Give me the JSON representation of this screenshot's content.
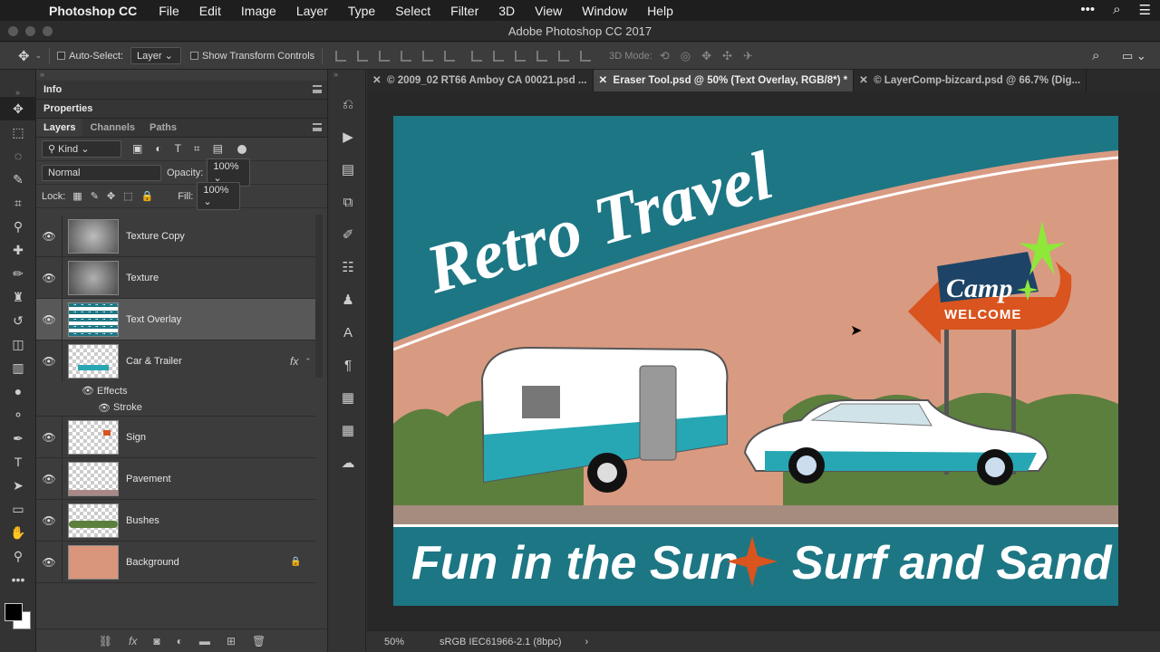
{
  "menubar": {
    "app": "Photoshop CC",
    "items": [
      "File",
      "Edit",
      "Image",
      "Layer",
      "Type",
      "Select",
      "Filter",
      "3D",
      "View",
      "Window",
      "Help"
    ]
  },
  "window": {
    "title": "Adobe Photoshop CC 2017"
  },
  "options": {
    "auto_select_label": "Auto-Select:",
    "auto_select_value": "Layer",
    "show_transform_label": "Show Transform Controls",
    "mode_3d_label": "3D Mode:"
  },
  "panels": {
    "info_title": "Info",
    "properties_title": "Properties",
    "tabs": [
      "Layers",
      "Channels",
      "Paths"
    ],
    "filter_kind": "Kind",
    "blend_mode": "Normal",
    "opacity_label": "Opacity:",
    "opacity_value": "100%",
    "lock_label": "Lock:",
    "fill_label": "Fill:",
    "fill_value": "100%",
    "layers": [
      {
        "name": "Texture Copy"
      },
      {
        "name": "Texture"
      },
      {
        "name": "Text Overlay"
      },
      {
        "name": "Car & Trailer",
        "fx": "fx"
      },
      {
        "name": "Sign"
      },
      {
        "name": "Pavement"
      },
      {
        "name": "Bushes"
      },
      {
        "name": "Background"
      }
    ],
    "effects_label": "Effects",
    "stroke_label": "Stroke"
  },
  "doc_tabs": [
    "© 2009_02 RT66 Amboy CA 00021.psd ...",
    "Eraser Tool.psd @ 50% (Text Overlay, RGB/8*) *",
    "© LayerComp-bizcard.psd @ 66.7% (Dig..."
  ],
  "artwork": {
    "headline": "Retro Travel",
    "sign_top": "Camp",
    "sign_bottom": "WELCOME",
    "tagline_left": "Fun in the Sun",
    "tagline_right": "Surf and Sand",
    "colors": {
      "teal": "#1d7684",
      "sky": "#d99a82",
      "orange": "#d9541e"
    }
  },
  "status": {
    "zoom": "50%",
    "profile": "sRGB IEC61966-2.1 (8bpc)"
  }
}
